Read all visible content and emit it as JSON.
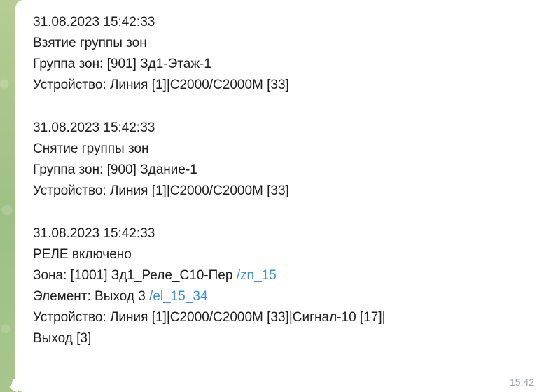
{
  "colors": {
    "background": "#a7c58c",
    "bubble": "#ffffff",
    "text": "#1c1c1c",
    "link": "#3a90d8",
    "timestamp": "#9ca0a3"
  },
  "message": {
    "events": [
      {
        "datetime": "31.08.2023 15:42:33",
        "title": "Взятие группы зон",
        "zone_group": "Группа зон: [901] Зд1-Этаж-1",
        "device": "Устройство: Линия [1]|С2000/С2000М [33]"
      },
      {
        "datetime": "31.08.2023 15:42:33",
        "title": "Снятие группы зон",
        "zone_group": "Группа зон: [900] Здание-1",
        "device": "Устройство: Линия [1]|С2000/С2000М [33]"
      },
      {
        "datetime": "31.08.2023 15:42:33",
        "title": "РЕЛЕ включено",
        "zone_text": "Зона: [1001] Зд1_Реле_С10-Пер ",
        "zone_link": "/zn_15",
        "element_text": "Элемент: Выход 3 ",
        "element_link": "/el_15_34",
        "device_line1": "Устройство: Линия [1]|С2000/С2000М [33]|Сигнал-10 [17]|",
        "device_line2": "Выход [3]"
      }
    ],
    "time": "15:42"
  }
}
